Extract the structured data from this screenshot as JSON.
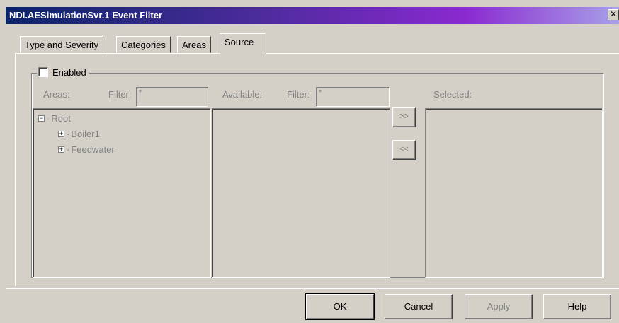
{
  "window": {
    "title": "NDI.AESimulationSvr.1 Event Filter",
    "close_glyph": "✕"
  },
  "tabs": [
    {
      "label": "Type and Severity",
      "active": false
    },
    {
      "label": "Categories",
      "active": false
    },
    {
      "label": "Areas",
      "active": false
    },
    {
      "label": "Source",
      "active": true
    }
  ],
  "group": {
    "enabled_label": "Enabled",
    "enabled_checked": false
  },
  "areas": {
    "label": "Areas:",
    "filter_label": "Filter:",
    "filter_value": "*",
    "tree": [
      {
        "label": "Root",
        "expander": "−",
        "level": 0
      },
      {
        "label": "Boiler1",
        "expander": "+",
        "level": 1
      },
      {
        "label": "Feedwater",
        "expander": "+",
        "level": 1
      }
    ]
  },
  "available": {
    "label": "Available:",
    "filter_label": "Filter:",
    "filter_value": "*"
  },
  "move": {
    "add_label": ">>",
    "remove_label": "<<"
  },
  "selected": {
    "label": "Selected:"
  },
  "buttons": {
    "ok": "OK",
    "cancel": "Cancel",
    "apply": "Apply",
    "help": "Help"
  },
  "colors": {
    "title_gradient_start": "#0a246a",
    "title_gradient_end": "#a8a0e8",
    "face": "#d4d0c8",
    "disabled_text": "#808080"
  }
}
